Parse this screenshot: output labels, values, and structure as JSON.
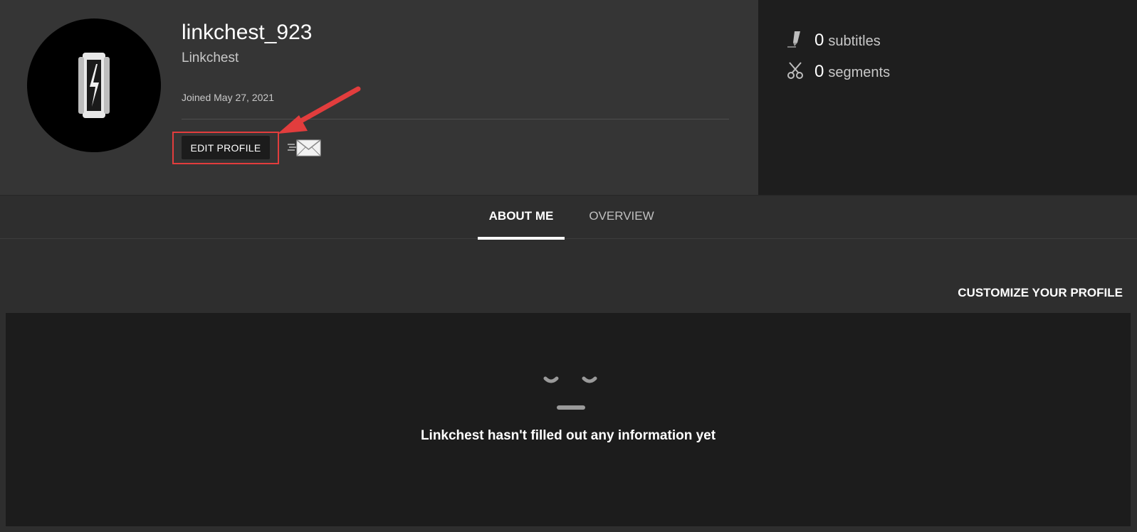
{
  "profile": {
    "username": "linkchest_923",
    "display_name": "Linkchest",
    "joined": "Joined May 27, 2021",
    "edit_button_label": "EDIT PROFILE"
  },
  "stats": {
    "subtitles": {
      "count": "0",
      "label": "subtitles",
      "icon": "pen-icon"
    },
    "segments": {
      "count": "0",
      "label": "segments",
      "icon": "scissors-icon"
    }
  },
  "tabs": [
    {
      "label": "ABOUT ME",
      "active": true
    },
    {
      "label": "OVERVIEW",
      "active": false
    }
  ],
  "content": {
    "customize_link": "CUSTOMIZE YOUR PROFILE",
    "empty_message": "Linkchest hasn't filled out any information yet"
  },
  "colors": {
    "header_bg": "#353535",
    "stats_bg": "#1e1e1e",
    "page_bg": "#2e2e2e",
    "panel_bg": "#1c1c1c",
    "annotation_red": "#e23d3d"
  }
}
